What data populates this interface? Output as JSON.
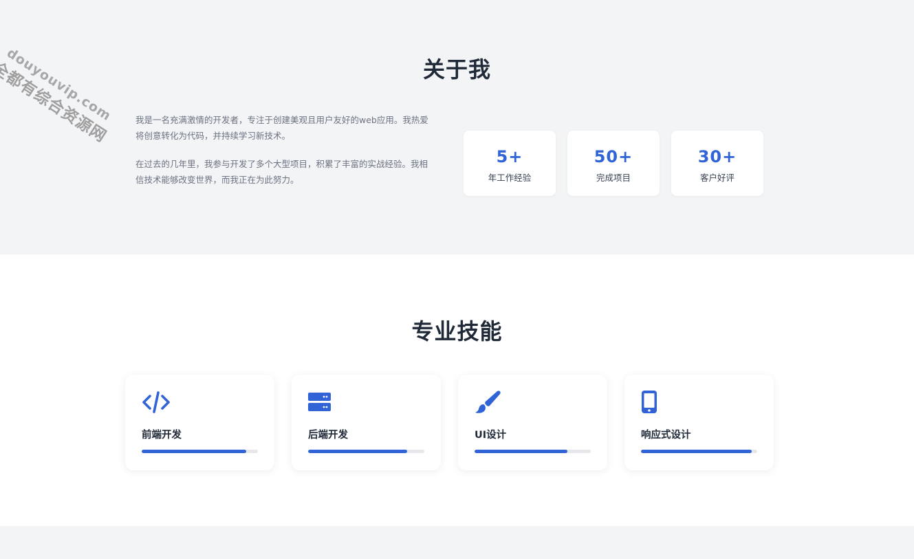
{
  "about": {
    "title": "关于我",
    "paragraphs": [
      "我是一名充满激情的开发者，专注于创建美观且用户友好的web应用。我热爱将创意转化为代码，并持续学习新技术。",
      "在过去的几年里，我参与开发了多个大型项目，积累了丰富的实战经验。我相信技术能够改变世界，而我正在为此努力。"
    ],
    "stats": [
      {
        "value": "5+",
        "label": "年工作经验"
      },
      {
        "value": "50+",
        "label": "完成项目"
      },
      {
        "value": "30+",
        "label": "客户好评"
      }
    ]
  },
  "skills": {
    "title": "专业技能",
    "items": [
      {
        "name": "前端开发",
        "icon": "code-icon",
        "level": 0.9
      },
      {
        "name": "后端开发",
        "icon": "server-icon",
        "level": 0.85
      },
      {
        "name": "UI设计",
        "icon": "paintbrush-icon",
        "level": 0.8
      },
      {
        "name": "响应式设计",
        "icon": "mobile-icon",
        "level": 0.95
      }
    ]
  },
  "watermark": {
    "line1": "全都有综合资源网",
    "line2": "douyouvip.com"
  },
  "colors": {
    "accent": "#2f63d6",
    "section_gray": "#f3f4f6",
    "heading": "#1f2937",
    "body_text": "#6b7280",
    "track": "#e5e7eb"
  }
}
